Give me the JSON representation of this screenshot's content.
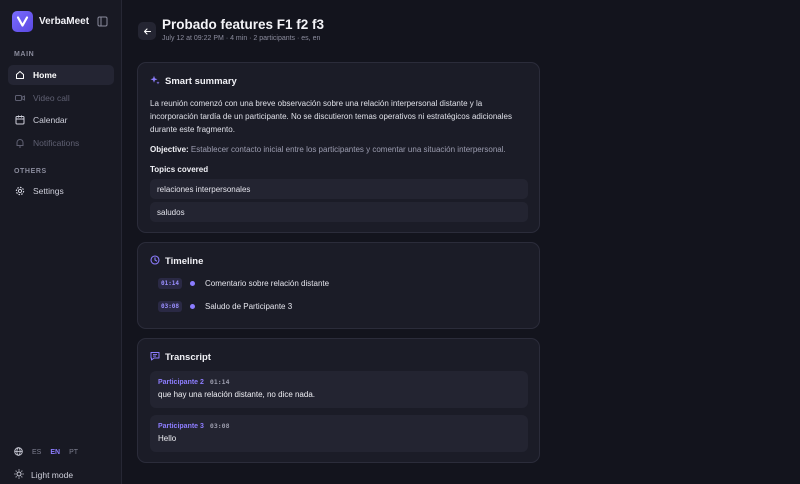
{
  "app": {
    "name": "VerbaMeet"
  },
  "sidebar": {
    "main_label": "MAIN",
    "others_label": "OTHERS",
    "items": [
      {
        "label": "Home",
        "icon": "home-icon",
        "state": "active"
      },
      {
        "label": "Video call",
        "icon": "video-icon",
        "state": "disabled"
      },
      {
        "label": "Calendar",
        "icon": "calendar-icon",
        "state": "normal"
      },
      {
        "label": "Notifications",
        "icon": "bell-icon",
        "state": "disabled"
      }
    ],
    "settings_label": "Settings",
    "languages": [
      "ES",
      "EN",
      "PT"
    ],
    "selected_language": "EN",
    "mode_label": "Light mode"
  },
  "page": {
    "title": "Probado features F1 f2 f3",
    "meta": "July 12 at 09:22 PM · 4 min · 2 participants · es, en"
  },
  "summary": {
    "title": "Smart summary",
    "text": "La reunión comenzó con una breve observación sobre una relación interpersonal distante y la incorporación tardía de un participante. No se discutieron temas operativos ni estratégicos adicionales durante este fragmento.",
    "objective_label": "Objective:",
    "objective_text": "Establecer contacto inicial entre los participantes y comentar una situación interpersonal.",
    "topics_label": "Topics covered",
    "topics": [
      "relaciones interpersonales",
      "saludos"
    ]
  },
  "timeline": {
    "title": "Timeline",
    "items": [
      {
        "time": "01:14",
        "text": "Comentario sobre relación distante"
      },
      {
        "time": "03:08",
        "text": "Saludo de Participante 3"
      }
    ]
  },
  "transcript": {
    "title": "Transcript",
    "messages": [
      {
        "speaker": "Participante 2",
        "time": "01:14",
        "text": "que hay una relación distante, no dice nada."
      },
      {
        "speaker": "Participante 3",
        "time": "03:08",
        "text": "Hello"
      }
    ]
  },
  "colors": {
    "background": "#13141d",
    "sidebar": "#181923",
    "card": "#1b1c27",
    "accent": "#8d7dff"
  }
}
